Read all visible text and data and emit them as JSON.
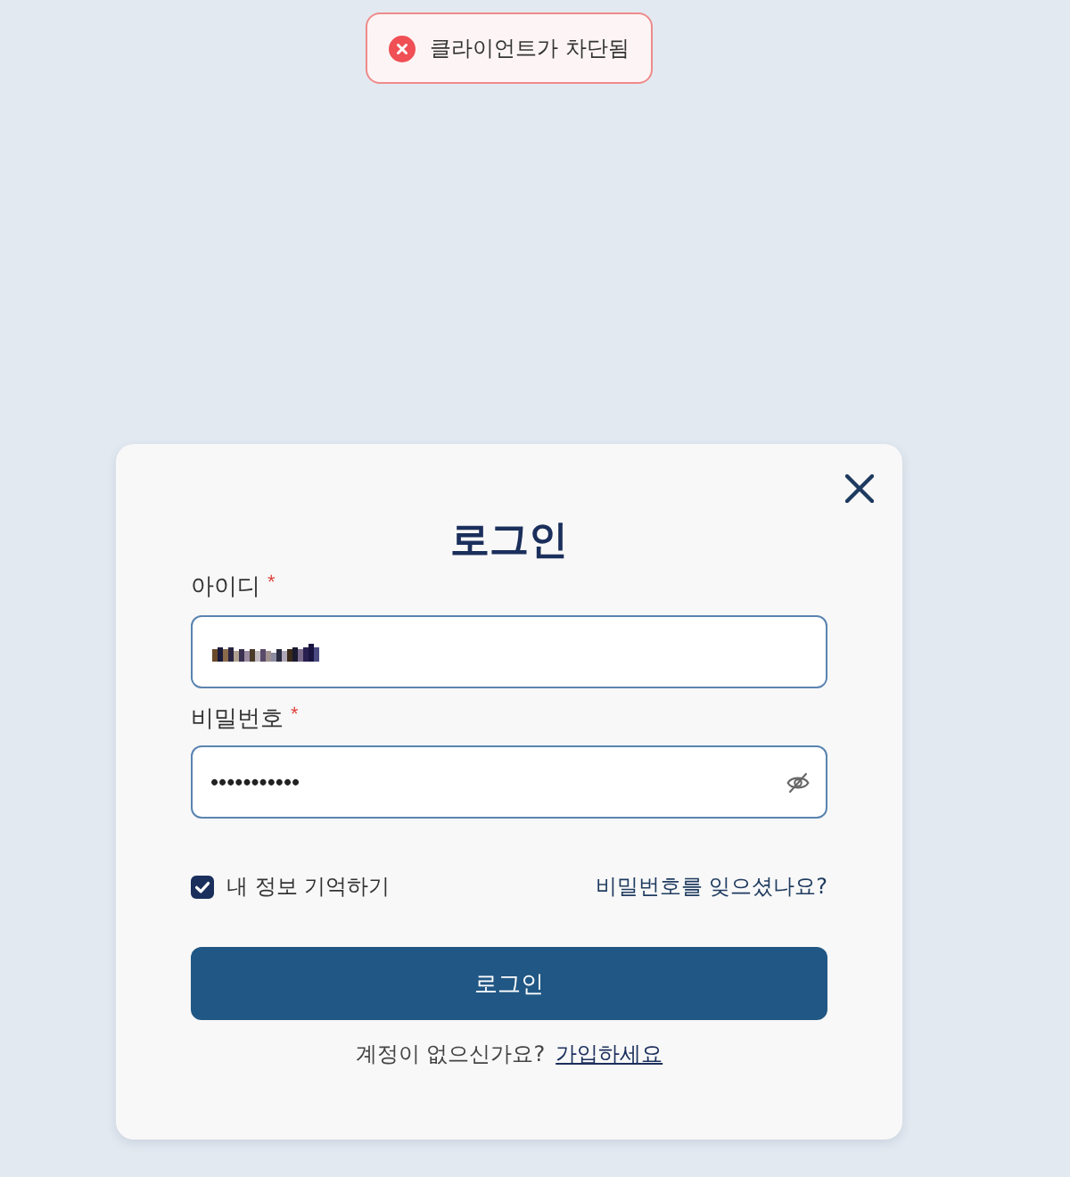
{
  "toast": {
    "kind": "error",
    "message": "클라이언트가 차단됨"
  },
  "dialog": {
    "title": "로그인",
    "fields": [
      {
        "kind": "text",
        "label": "아이디",
        "required_mark": "*",
        "obscured": true
      },
      {
        "kind": "password",
        "label": "비밀번호",
        "required_mark": "*",
        "value": "•••••••••••"
      }
    ],
    "remember": {
      "label": "내 정보 기억하기",
      "checked": true
    },
    "forgot_link": "비밀번호를 잊으셨나요?",
    "submit": "로그인",
    "signup": {
      "prompt": "계정이 없으신가요?",
      "link": "가입하세요"
    }
  }
}
